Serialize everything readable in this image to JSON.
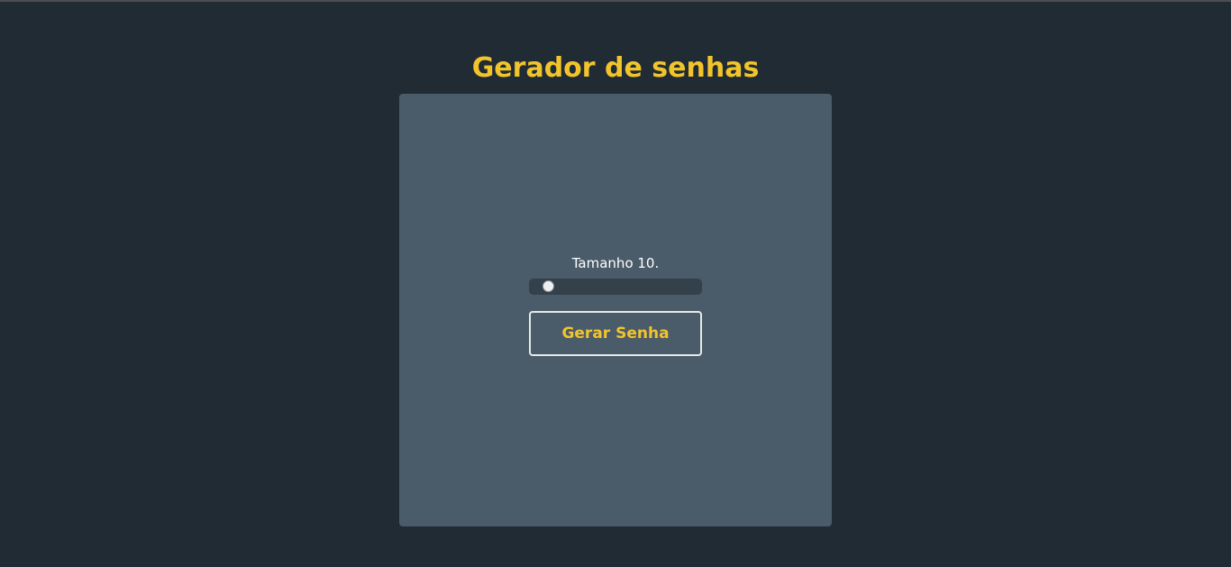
{
  "page": {
    "title": "Gerador de senhas"
  },
  "generator": {
    "size_label": "Tamanho 10.",
    "slider": {
      "value": 10,
      "min": 8,
      "max": 64
    },
    "button_label": "Gerar Senha"
  },
  "colors": {
    "background": "#202b33",
    "card": "#4a5b69",
    "accent": "#f2c42c",
    "slider_track": "#34414b"
  }
}
